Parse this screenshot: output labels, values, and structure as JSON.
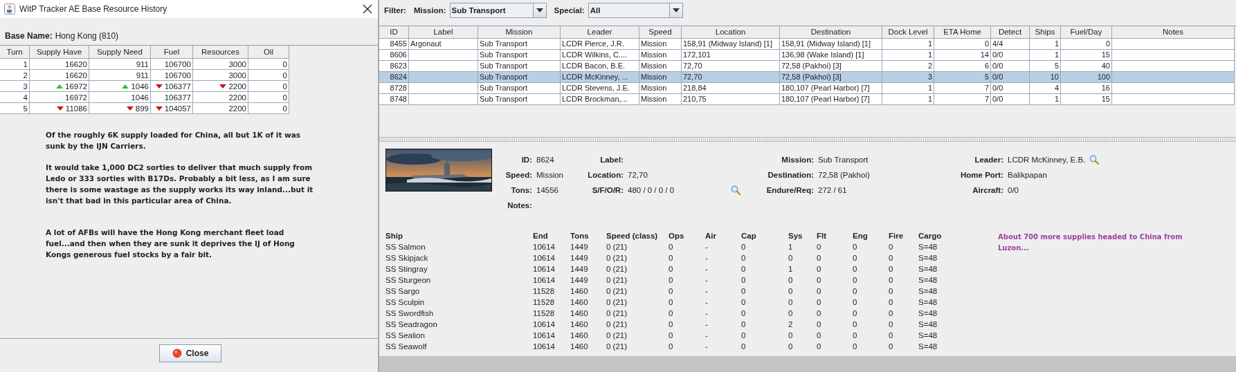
{
  "left_window": {
    "title": "WitP Tracker AE Base Resource History",
    "base_name": {
      "label": "Base Name:",
      "value": "Hong Kong (810)"
    },
    "history_table": {
      "columns": [
        "Turn",
        "Supply Have",
        "Supply Need",
        "Fuel",
        "Resources",
        "Oil"
      ],
      "rows": [
        [
          {
            "text": "1",
            "kind": "plain"
          },
          {
            "text": "16620",
            "kind": "plain"
          },
          {
            "text": "911",
            "kind": "plain"
          },
          {
            "text": "106700",
            "kind": "plain"
          },
          {
            "text": "3000",
            "kind": "plain"
          },
          {
            "text": "0",
            "kind": "plain"
          }
        ],
        [
          {
            "text": "2",
            "kind": "plain"
          },
          {
            "text": "16620",
            "kind": "plain"
          },
          {
            "text": "911",
            "kind": "plain"
          },
          {
            "text": "106700",
            "kind": "plain"
          },
          {
            "text": "3000",
            "kind": "plain"
          },
          {
            "text": "0",
            "kind": "plain"
          }
        ],
        [
          {
            "text": "3",
            "kind": "plain"
          },
          {
            "text": "16972",
            "kind": "up"
          },
          {
            "text": "1046",
            "kind": "up"
          },
          {
            "text": "106377",
            "kind": "down"
          },
          {
            "text": "2200",
            "kind": "down"
          },
          {
            "text": "0",
            "kind": "plain"
          }
        ],
        [
          {
            "text": "4",
            "kind": "plain"
          },
          {
            "text": "16972",
            "kind": "plain"
          },
          {
            "text": "1046",
            "kind": "plain"
          },
          {
            "text": "106377",
            "kind": "plain"
          },
          {
            "text": "2200",
            "kind": "plain"
          },
          {
            "text": "0",
            "kind": "plain"
          }
        ],
        [
          {
            "text": "5",
            "kind": "plain"
          },
          {
            "text": "11086",
            "kind": "down"
          },
          {
            "text": "899",
            "kind": "down"
          },
          {
            "text": "104057",
            "kind": "down"
          },
          {
            "text": "2200",
            "kind": "plain"
          },
          {
            "text": "0",
            "kind": "plain"
          }
        ]
      ]
    },
    "comment": [
      "Of the roughly 6K supply loaded for China, all but 1K of it was sunk by the IJN Carriers.",
      "It would take 1,000 DC2 sorties to deliver that much supply from Ledo or 333 sorties with B17Ds.  Probably a bit less, as I am sure there is some wastage as the supply works its way inland...but it isn't that bad in this particular area of China.",
      "A lot of AFBs will have the Hong Kong merchant fleet load fuel...and then when they are sunk it deprives the IJ of Hong Kongs generous fuel stocks by a fair bit."
    ],
    "close_button": "Close"
  },
  "filter_bar": {
    "label": "Filter:",
    "mission": {
      "label": "Mission:",
      "value": "Sub Transport"
    },
    "special": {
      "label": "Special:",
      "value": "All"
    }
  },
  "task_force_table": {
    "columns": [
      "ID",
      "Label",
      "Mission",
      "Leader",
      "Speed",
      "Location",
      "Destination",
      "Dock Level",
      "ETA Home",
      "Detect",
      "Ships",
      "Fuel/Day",
      "Notes"
    ],
    "rows": [
      {
        "selected": false,
        "cells": [
          "8455",
          "Argonaut",
          "Sub Transport",
          "LCDR Pierce, J.R.",
          "Mission",
          "158,91 (Midway Island) [1]",
          "158,91 (Midway Island) [1]",
          "1",
          "0",
          "4/4",
          "1",
          "0",
          ""
        ]
      },
      {
        "selected": false,
        "cells": [
          "8606",
          "",
          "Sub Transport",
          "LCDR Wilkins, C....",
          "Mission",
          "172,101",
          "136,98 (Wake Island) [1]",
          "1",
          "14",
          "0/0",
          "1",
          "15",
          ""
        ]
      },
      {
        "selected": false,
        "cells": [
          "8623",
          "",
          "Sub Transport",
          "LCDR Bacon, B.E.",
          "Mission",
          "72,70",
          "72,58 (Pakhoi) [3]",
          "2",
          "6",
          "0/0",
          "5",
          "40",
          ""
        ]
      },
      {
        "selected": true,
        "cells": [
          "8624",
          "",
          "Sub Transport",
          "LCDR McKinney, ...",
          "Mission",
          "72,70",
          "72,58 (Pakhoi) [3]",
          "3",
          "5",
          "0/0",
          "10",
          "100",
          ""
        ]
      },
      {
        "selected": false,
        "cells": [
          "8728",
          "",
          "Sub Transport",
          "LCDR Stevens, J.E.",
          "Mission",
          "218,84",
          "180,107 (Pearl Harbor) [7]",
          "1",
          "7",
          "0/0",
          "4",
          "16",
          ""
        ]
      },
      {
        "selected": false,
        "cells": [
          "8748",
          "",
          "Sub Transport",
          "LCDR Brockman,...",
          "Mission",
          "210,75",
          "180,107 (Pearl Harbor) [7]",
          "1",
          "7",
          "0/0",
          "1",
          "15",
          ""
        ]
      }
    ]
  },
  "details": {
    "fields": [
      {
        "label": "ID:",
        "value": "8624",
        "kind": "text"
      },
      {
        "label": "Label:",
        "kind": "text"
      },
      {
        "label": "Mission:",
        "value": "Sub Transport",
        "kind": "text"
      },
      {
        "label": "Leader:",
        "value": "LCDR McKinney, E.B.",
        "kind": "lookup"
      },
      {
        "label": "Speed:",
        "value": "Mission",
        "kind": "text"
      },
      {
        "label": "Location:",
        "value": "72,70",
        "kind": "text"
      },
      {
        "label": "Destination:",
        "value": "72,58 (Pakhoi)",
        "kind": "text"
      },
      {
        "label": "Home Port:",
        "value": "Balikpapan",
        "kind": "text"
      },
      {
        "label": "Tons:",
        "value": "14556",
        "kind": "text"
      },
      {
        "label": "S/F/O/R:",
        "value": "480 / 0 / 0 / 0",
        "kind": "lookup"
      },
      {
        "label": "Endure/Req:",
        "value": "272 / 61",
        "kind": "text"
      },
      {
        "label": "Aircraft:",
        "value": "0/0",
        "kind": "text"
      },
      {
        "label": "Notes:",
        "kind": "text"
      }
    ],
    "ships": {
      "columns": [
        "Ship",
        "End",
        "Tons",
        "Speed (class)",
        "Ops",
        "Air",
        "Cap",
        "Sys",
        "Flt",
        "Eng",
        "Fire",
        "Cargo"
      ],
      "rows": [
        [
          "SS Salmon",
          "10614",
          "1449",
          "0 (21)",
          "0",
          "-",
          "0",
          "1",
          "0",
          "0",
          "0",
          "S=48"
        ],
        [
          "SS Skipjack",
          "10614",
          "1449",
          "0 (21)",
          "0",
          "-",
          "0",
          "0",
          "0",
          "0",
          "0",
          "S=48"
        ],
        [
          "SS Stingray",
          "10614",
          "1449",
          "0 (21)",
          "0",
          "-",
          "0",
          "1",
          "0",
          "0",
          "0",
          "S=48"
        ],
        [
          "SS Sturgeon",
          "10614",
          "1449",
          "0 (21)",
          "0",
          "-",
          "0",
          "0",
          "0",
          "0",
          "0",
          "S=48"
        ],
        [
          "SS Sargo",
          "11528",
          "1460",
          "0 (21)",
          "0",
          "-",
          "0",
          "0",
          "0",
          "0",
          "0",
          "S=48"
        ],
        [
          "SS Sculpin",
          "11528",
          "1460",
          "0 (21)",
          "0",
          "-",
          "0",
          "0",
          "0",
          "0",
          "0",
          "S=48"
        ],
        [
          "SS Swordfish",
          "11528",
          "1460",
          "0 (21)",
          "0",
          "-",
          "0",
          "0",
          "0",
          "0",
          "0",
          "S=48"
        ],
        [
          "SS Seadragon",
          "10614",
          "1460",
          "0 (21)",
          "0",
          "-",
          "0",
          "2",
          "0",
          "0",
          "0",
          "S=48"
        ],
        [
          "SS Sealion",
          "10614",
          "1460",
          "0 (21)",
          "0",
          "-",
          "0",
          "0",
          "0",
          "0",
          "0",
          "S=48"
        ],
        [
          "SS Seawolf",
          "10614",
          "1460",
          "0 (21)",
          "0",
          "-",
          "0",
          "0",
          "0",
          "0",
          "0",
          "S=48"
        ]
      ]
    },
    "note": "About 700 more supplies headed to China from Luzon..."
  }
}
